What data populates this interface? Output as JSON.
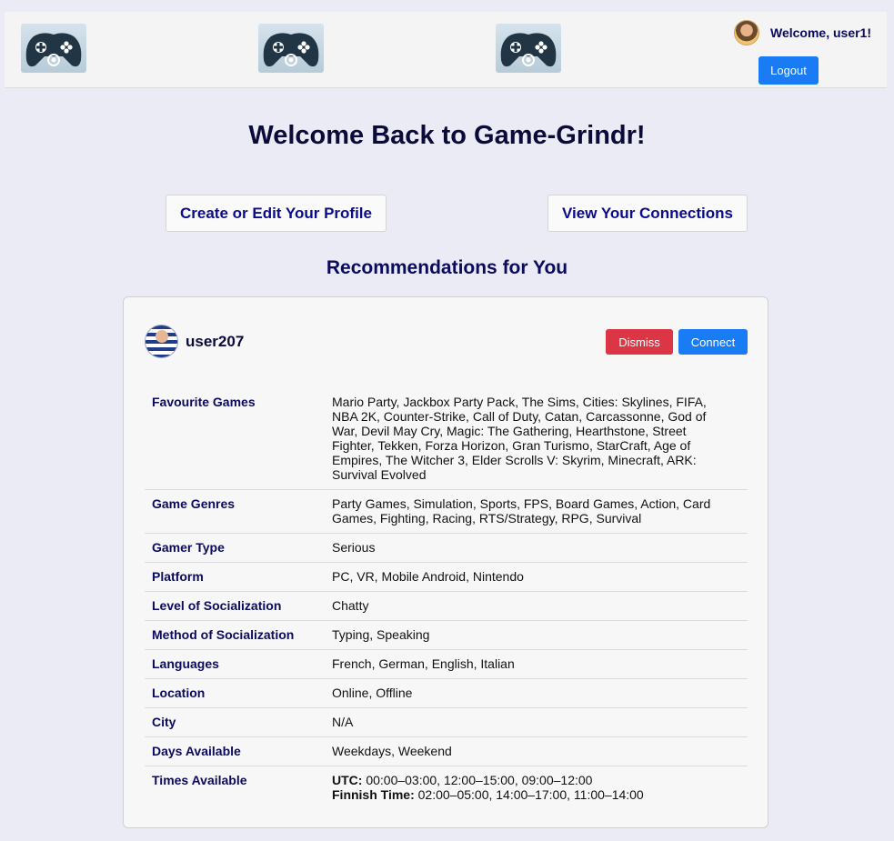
{
  "header": {
    "logo_icon": "gamepad-logo-icon",
    "welcome_text": "Welcome, user1!",
    "logout_label": "Logout"
  },
  "main": {
    "title": "Welcome Back to Game-Grindr!",
    "buttons": {
      "profile_label": "Create or Edit Your Profile",
      "connections_label": "View Your Connections"
    },
    "recommendations_title": "Recommendations for You"
  },
  "recommendation": {
    "username": "user207",
    "dismiss_label": "Dismiss",
    "connect_label": "Connect",
    "details": [
      {
        "label": "Favourite Games",
        "value": "Mario Party, Jackbox Party Pack, The Sims, Cities: Skylines, FIFA, NBA 2K, Counter-Strike, Call of Duty, Catan, Carcassonne, God of War, Devil May Cry, Magic: The Gathering, Hearthstone, Street Fighter, Tekken, Forza Horizon, Gran Turismo, StarCraft, Age of Empires, The Witcher 3, Elder Scrolls V: Skyrim, Minecraft, ARK: Survival Evolved"
      },
      {
        "label": "Game Genres",
        "value": "Party Games, Simulation, Sports, FPS, Board Games, Action, Card Games, Fighting, Racing, RTS/Strategy, RPG, Survival"
      },
      {
        "label": "Gamer Type",
        "value": "Serious"
      },
      {
        "label": "Platform",
        "value": "PC, VR, Mobile Android, Nintendo"
      },
      {
        "label": "Level of Socialization",
        "value": "Chatty"
      },
      {
        "label": "Method of Socialization",
        "value": "Typing, Speaking"
      },
      {
        "label": "Languages",
        "value": "French, German, English, Italian"
      },
      {
        "label": "Location",
        "value": "Online, Offline"
      },
      {
        "label": "City",
        "value": "N/A"
      },
      {
        "label": "Days Available",
        "value": "Weekdays, Weekend"
      }
    ],
    "times": {
      "label": "Times Available",
      "utc_label": "UTC:",
      "utc_value": " 00:00–03:00, 12:00–15:00, 09:00–12:00",
      "local_label": "Finnish Time:",
      "local_value": " 02:00–05:00, 14:00–17:00, 11:00–14:00"
    }
  },
  "colors": {
    "background": "#ebebf5",
    "primary": "#1a7cf5",
    "danger": "#dc3545",
    "heading": "#0b0b5e"
  }
}
